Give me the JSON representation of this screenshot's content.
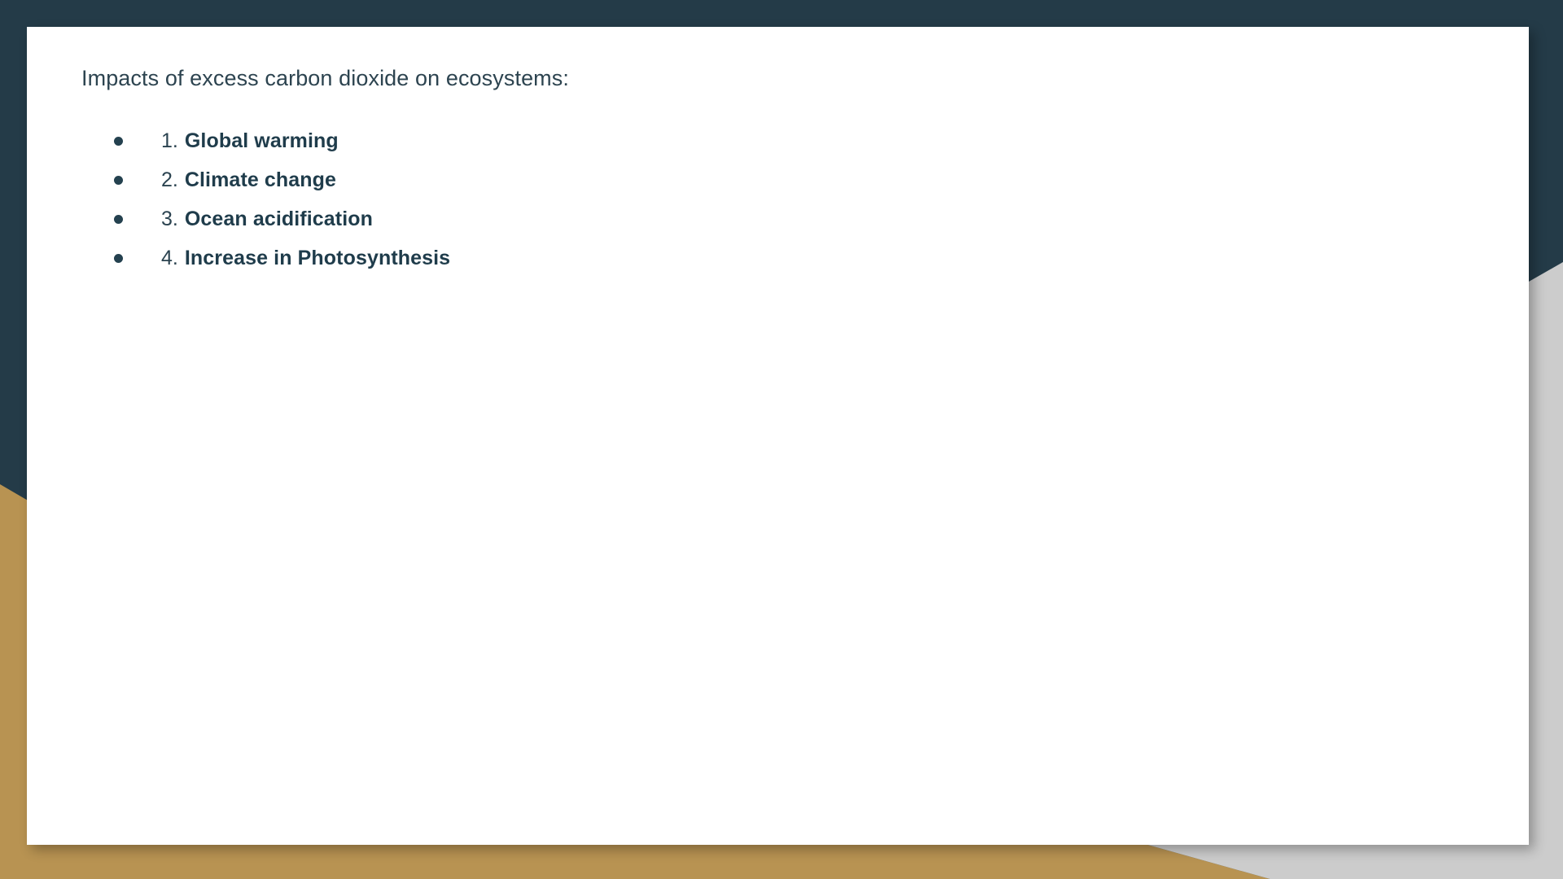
{
  "slide": {
    "background_color": "#243b48",
    "card_color": "#ffffff",
    "accent_gold": "#b89352",
    "accent_gray": "#cccccc",
    "heading_color": "#2d4450",
    "text_color": "#1f3c4b",
    "heading": "Impacts of excess carbon dioxide on ecosystems:",
    "bullets": [
      {
        "marker": "bullet-dot",
        "number": "1.",
        "text": "Global warming"
      },
      {
        "marker": "bullet-dot",
        "number": "2.",
        "text": "Climate change"
      },
      {
        "marker": "bullet-dot",
        "number": "3.",
        "text": "Ocean acidification"
      },
      {
        "marker": "bullet-dot",
        "number": "4.",
        "text": "Increase in Photosynthesis"
      }
    ]
  }
}
